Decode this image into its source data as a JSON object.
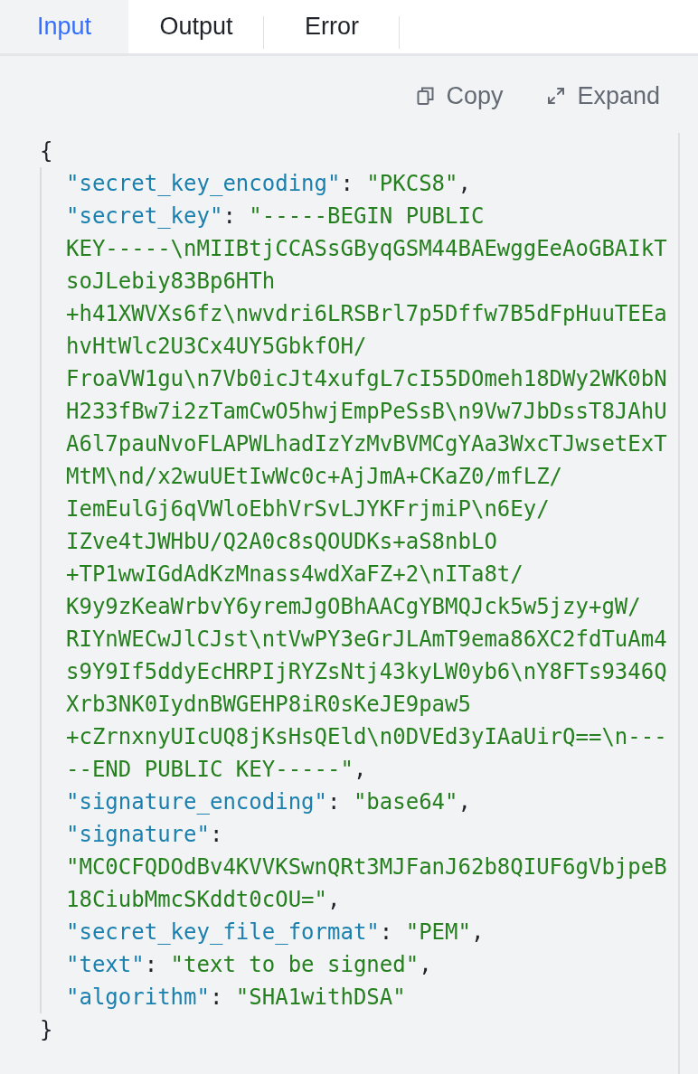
{
  "tabs": [
    {
      "label": "Input",
      "selected": true
    },
    {
      "label": "Output",
      "selected": false
    },
    {
      "label": "Error",
      "selected": false
    }
  ],
  "toolbar": [
    {
      "kind": "copy",
      "label": "Copy"
    },
    {
      "kind": "expand",
      "label": "Expand"
    }
  ],
  "code": {
    "open": "{",
    "close": "}",
    "children": [
      [
        {
          "kind": "key",
          "text": "\"secret_key_encoding\""
        },
        {
          "kind": "punct",
          "text": ": "
        },
        {
          "kind": "string",
          "text": "\"PKCS8\""
        },
        {
          "kind": "punct",
          "text": ","
        }
      ],
      [
        {
          "kind": "key",
          "text": "\"secret_key\""
        },
        {
          "kind": "punct",
          "text": ": "
        },
        {
          "kind": "string",
          "text": "\"-----BEGIN PUBLIC"
        }
      ],
      [
        {
          "kind": "string",
          "text": "KEY-----\\nMIIBtjCCASsGByqGSM44BAEwggEeAoGBAIkT"
        }
      ],
      [
        {
          "kind": "string",
          "text": "soJLebiy83Bp6HTh"
        }
      ],
      [
        {
          "kind": "string",
          "text": "+h41XWVXs6fz\\nwvdri6LRSBrl7p5Dffw7B5dFpHuuTEEa"
        }
      ],
      [
        {
          "kind": "string",
          "text": "hvHtWlc2U3Cx4UY5GbkfOH/"
        }
      ],
      [
        {
          "kind": "string",
          "text": "FroaVW1gu\\n7Vb0icJt4xufgL7cI55DOmeh18DWy2WK0bN"
        }
      ],
      [
        {
          "kind": "string",
          "text": "H233fBw7i2zTamCwO5hwjEmpPeSsB\\n9Vw7JbDssT8JAhU"
        }
      ],
      [
        {
          "kind": "string",
          "text": "A6l7pauNvoFLAPWLhadIzYzMvBVMCgYAa3WxcTJwsetExT"
        }
      ],
      [
        {
          "kind": "string",
          "text": "MtM\\nd/x2wuUEtIwWc0c+AjJmA+CKaZ0/mfLZ/"
        }
      ],
      [
        {
          "kind": "string",
          "text": "IemEulGj6qVWloEbhVrSvLJYKFrjmiP\\n6Ey/"
        }
      ],
      [
        {
          "kind": "string",
          "text": "IZve4tJWHbU/Q2A0c8sQOUDKs+aS8nbLO"
        }
      ],
      [
        {
          "kind": "string",
          "text": "+TP1wwIGdAdKzMnass4wdXaFZ+2\\nITa8t/"
        }
      ],
      [
        {
          "kind": "string",
          "text": "K9y9zKeaWrbvY6yremJgOBhAACgYBMQJck5w5jzy+gW/"
        }
      ],
      [
        {
          "kind": "string",
          "text": "RIYnWECwJlCJst\\ntVwPY3eGrJLAmT9ema86XC2fdTuAm4"
        }
      ],
      [
        {
          "kind": "string",
          "text": "s9Y9If5ddyEcHRPIjRYZsNtj43kyLW0yb6\\nY8FTs9346Q"
        }
      ],
      [
        {
          "kind": "string",
          "text": "Xrb3NK0IydnBWGEHP8iR0sKeJE9paw5"
        }
      ],
      [
        {
          "kind": "string",
          "text": "+cZrnxnyUIcUQ8jKsHsQEld\\n0DVEd3yIAaUirQ==\\n---"
        }
      ],
      [
        {
          "kind": "string",
          "text": "--END PUBLIC KEY-----\""
        },
        {
          "kind": "punct",
          "text": ","
        }
      ],
      [
        {
          "kind": "key",
          "text": "\"signature_encoding\""
        },
        {
          "kind": "punct",
          "text": ": "
        },
        {
          "kind": "string",
          "text": "\"base64\""
        },
        {
          "kind": "punct",
          "text": ","
        }
      ],
      [
        {
          "kind": "key",
          "text": "\"signature\""
        },
        {
          "kind": "punct",
          "text": ":"
        }
      ],
      [
        {
          "kind": "string",
          "text": "\"MC0CFQDOdBv4KVVKSwnQRt3MJFanJ62b8QIUF6gVbjpeB"
        }
      ],
      [
        {
          "kind": "string",
          "text": "18CiubMmcSKddt0cOU=\""
        },
        {
          "kind": "punct",
          "text": ","
        }
      ],
      [
        {
          "kind": "key",
          "text": "\"secret_key_file_format\""
        },
        {
          "kind": "punct",
          "text": ": "
        },
        {
          "kind": "string",
          "text": "\"PEM\""
        },
        {
          "kind": "punct",
          "text": ","
        }
      ],
      [
        {
          "kind": "key",
          "text": "\"text\""
        },
        {
          "kind": "punct",
          "text": ": "
        },
        {
          "kind": "string",
          "text": "\"text to be signed\""
        },
        {
          "kind": "punct",
          "text": ","
        }
      ],
      [
        {
          "kind": "key",
          "text": "\"algorithm\""
        },
        {
          "kind": "punct",
          "text": ": "
        },
        {
          "kind": "string",
          "text": "\"SHA1withDSA\""
        }
      ]
    ]
  }
}
